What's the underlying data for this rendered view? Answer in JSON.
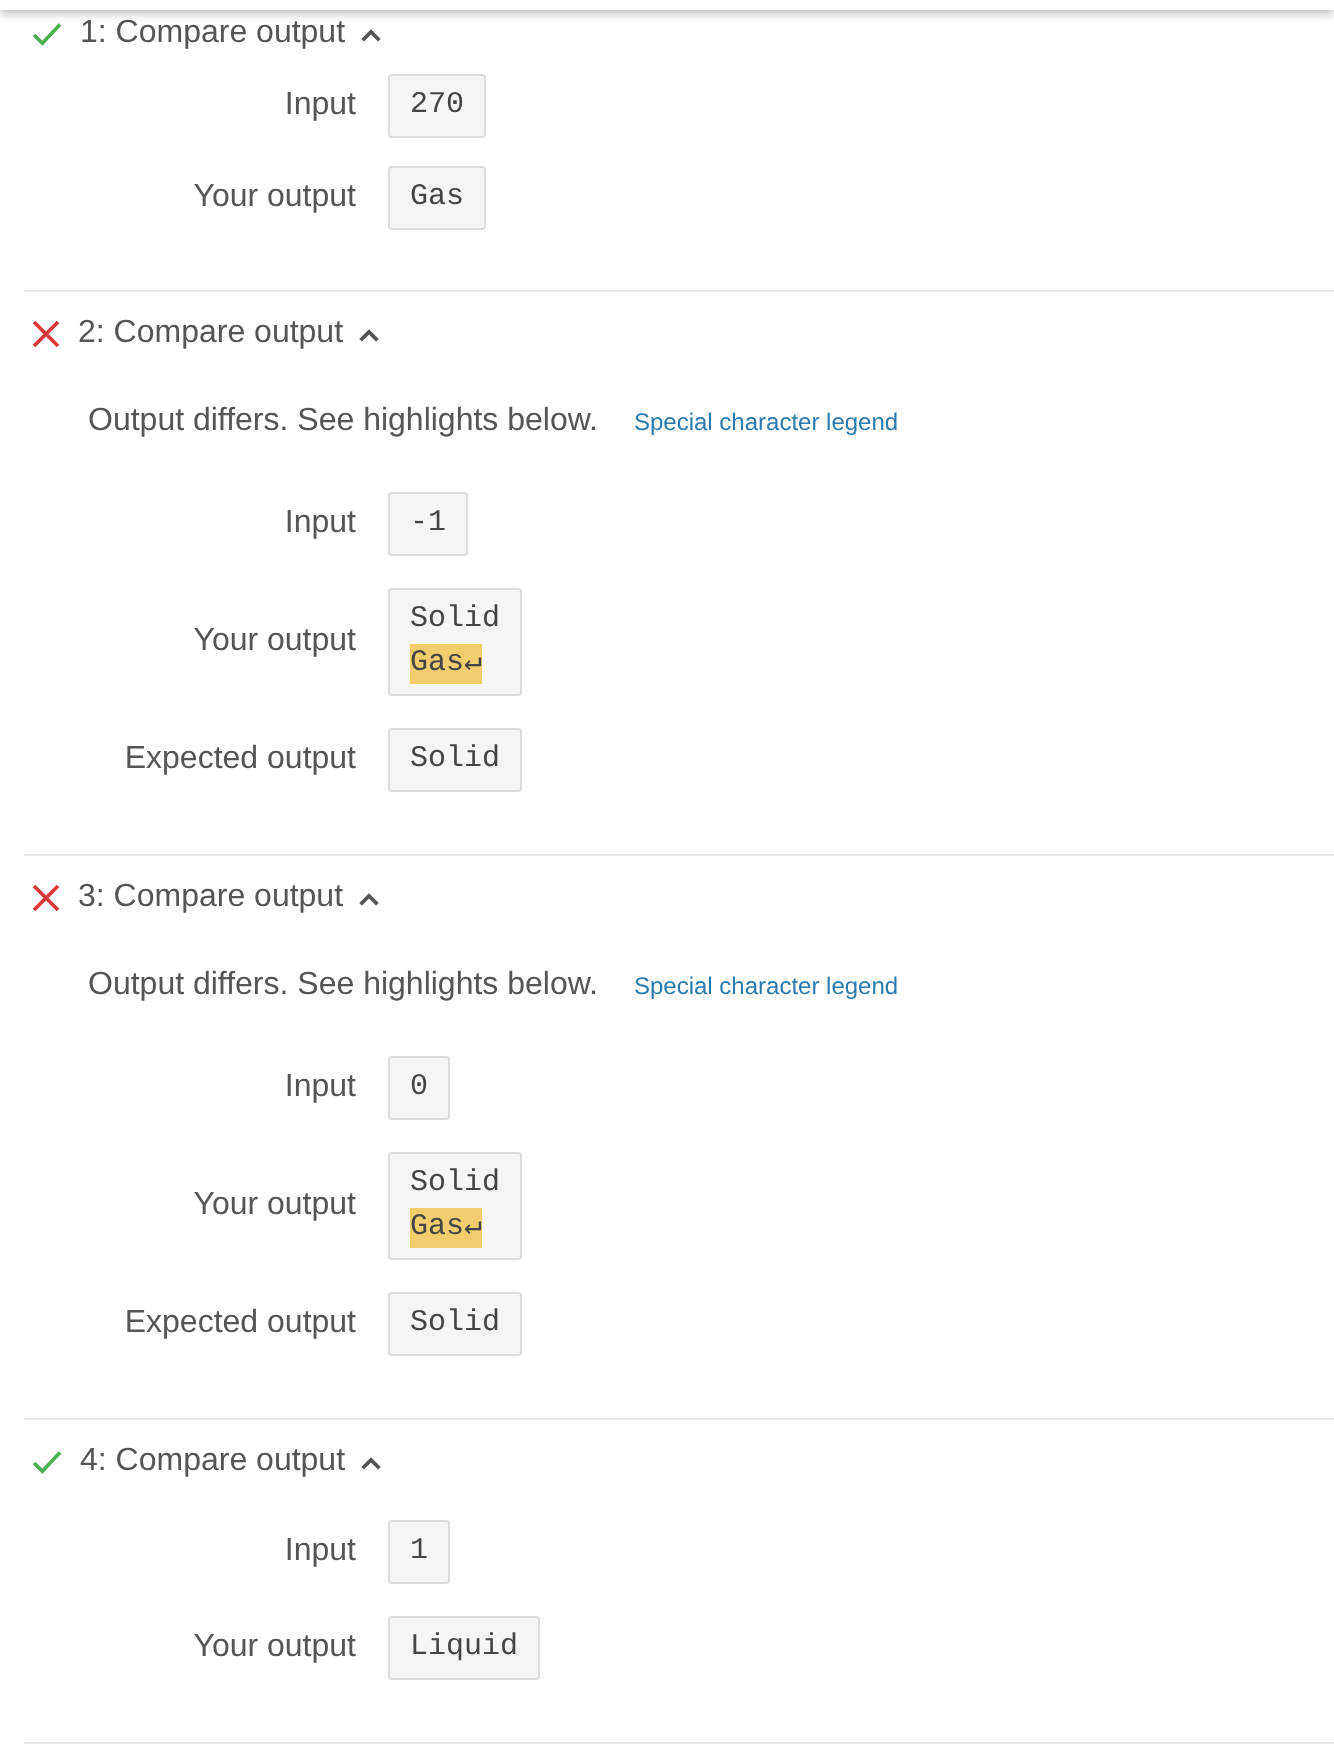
{
  "tests": [
    {
      "title": "1: Compare output",
      "passed": true,
      "expanded": true,
      "rows": [
        {
          "label": "Input",
          "lines": [
            {
              "text": "270",
              "highlighted": false
            }
          ]
        },
        {
          "label": "Your output",
          "lines": [
            {
              "text": "Gas",
              "highlighted": false
            }
          ]
        }
      ]
    },
    {
      "title": "2: Compare output",
      "passed": false,
      "expanded": true,
      "message": {
        "text": "Output differs. See highlights below.",
        "link": "Special character legend"
      },
      "rows": [
        {
          "label": "Input",
          "lines": [
            {
              "text": "-1",
              "highlighted": false
            }
          ]
        },
        {
          "label": "Your output",
          "lines": [
            {
              "text": "Solid",
              "highlighted": false
            },
            {
              "text": "Gas↵",
              "highlighted": true
            }
          ]
        },
        {
          "label": "Expected output",
          "lines": [
            {
              "text": "Solid",
              "highlighted": false
            }
          ]
        }
      ]
    },
    {
      "title": "3: Compare output",
      "passed": false,
      "expanded": true,
      "message": {
        "text": "Output differs. See highlights below.",
        "link": "Special character legend"
      },
      "rows": [
        {
          "label": "Input",
          "lines": [
            {
              "text": "0",
              "highlighted": false
            }
          ]
        },
        {
          "label": "Your output",
          "lines": [
            {
              "text": "Solid",
              "highlighted": false
            },
            {
              "text": "Gas↵",
              "highlighted": true
            }
          ]
        },
        {
          "label": "Expected output",
          "lines": [
            {
              "text": "Solid",
              "highlighted": false
            }
          ]
        }
      ]
    },
    {
      "title": "4: Compare output",
      "passed": true,
      "expanded": true,
      "rows": [
        {
          "label": "Input",
          "lines": [
            {
              "text": "1",
              "highlighted": false
            }
          ]
        },
        {
          "label": "Your output",
          "lines": [
            {
              "text": "Liquid",
              "highlighted": false
            }
          ]
        }
      ]
    }
  ]
}
